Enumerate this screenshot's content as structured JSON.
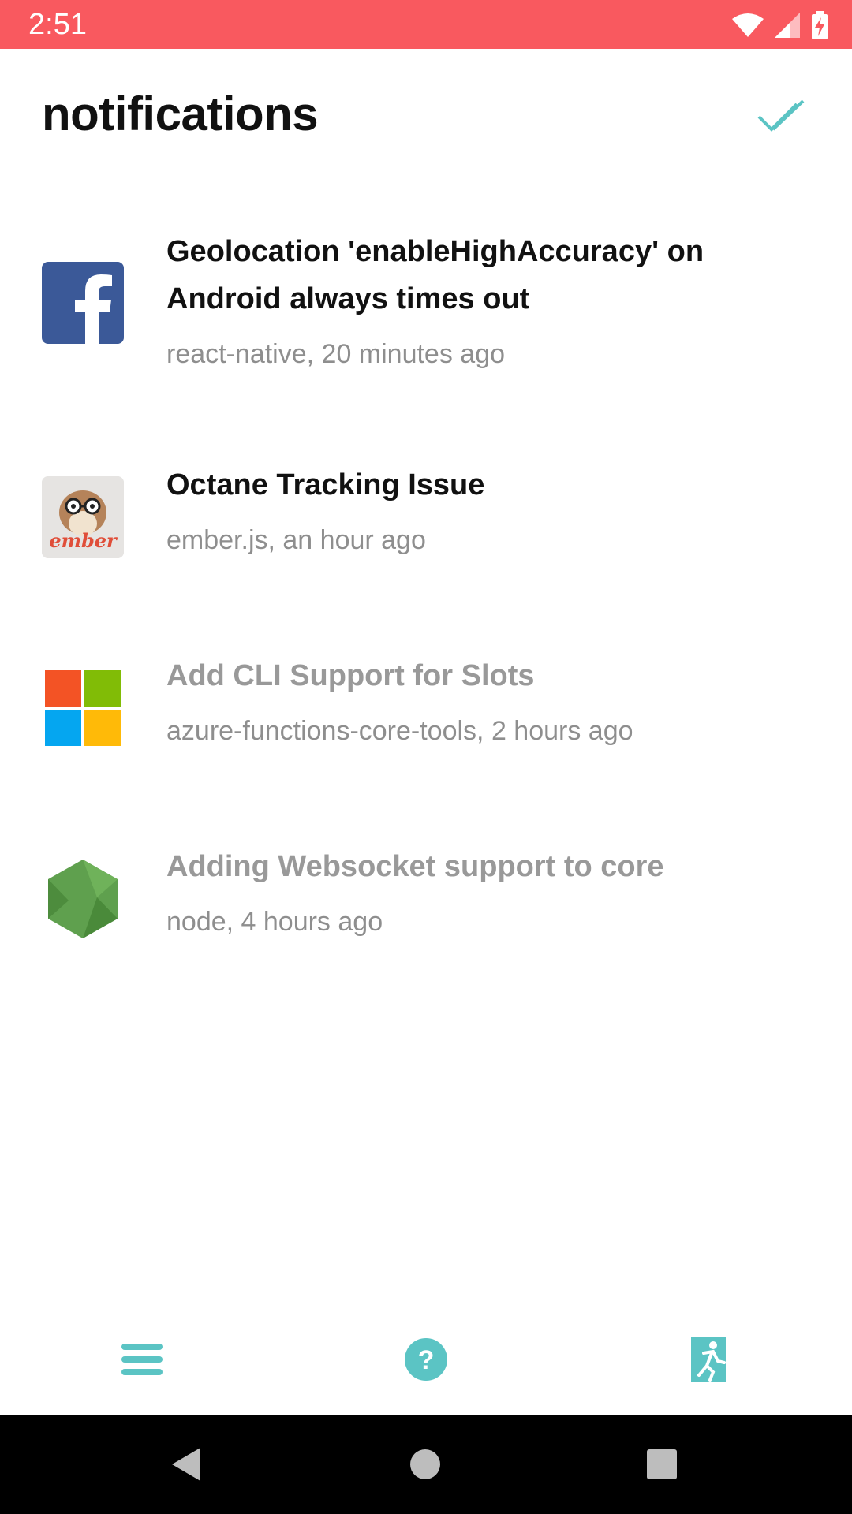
{
  "status_bar": {
    "time": "2:51"
  },
  "header": {
    "title": "notifications",
    "mark_all_read_icon": "double-check-icon"
  },
  "notifications": [
    {
      "title": "Geolocation 'enableHighAccuracy' on Android always times out",
      "meta": "react-native, 20 minutes ago",
      "avatar": "facebook-logo",
      "read": false
    },
    {
      "title": "Octane Tracking Issue",
      "meta": "ember.js, an hour ago",
      "avatar": "ember-logo",
      "read": false
    },
    {
      "title": "Add CLI Support for Slots",
      "meta": "azure-functions-core-tools, 2 hours ago",
      "avatar": "microsoft-logo",
      "read": true
    },
    {
      "title": "Adding Websocket support to core",
      "meta": "node, 4 hours ago",
      "avatar": "nodejs-logo",
      "read": true
    }
  ],
  "bottom_nav": {
    "items": [
      {
        "icon": "menu-icon"
      },
      {
        "icon": "help-icon"
      },
      {
        "icon": "exit-icon"
      }
    ]
  },
  "colors": {
    "status_bar": "#f9595f",
    "accent": "#5bc4c4",
    "title_unread": "#111111",
    "title_read": "#999999",
    "meta": "#8e8e8e"
  }
}
